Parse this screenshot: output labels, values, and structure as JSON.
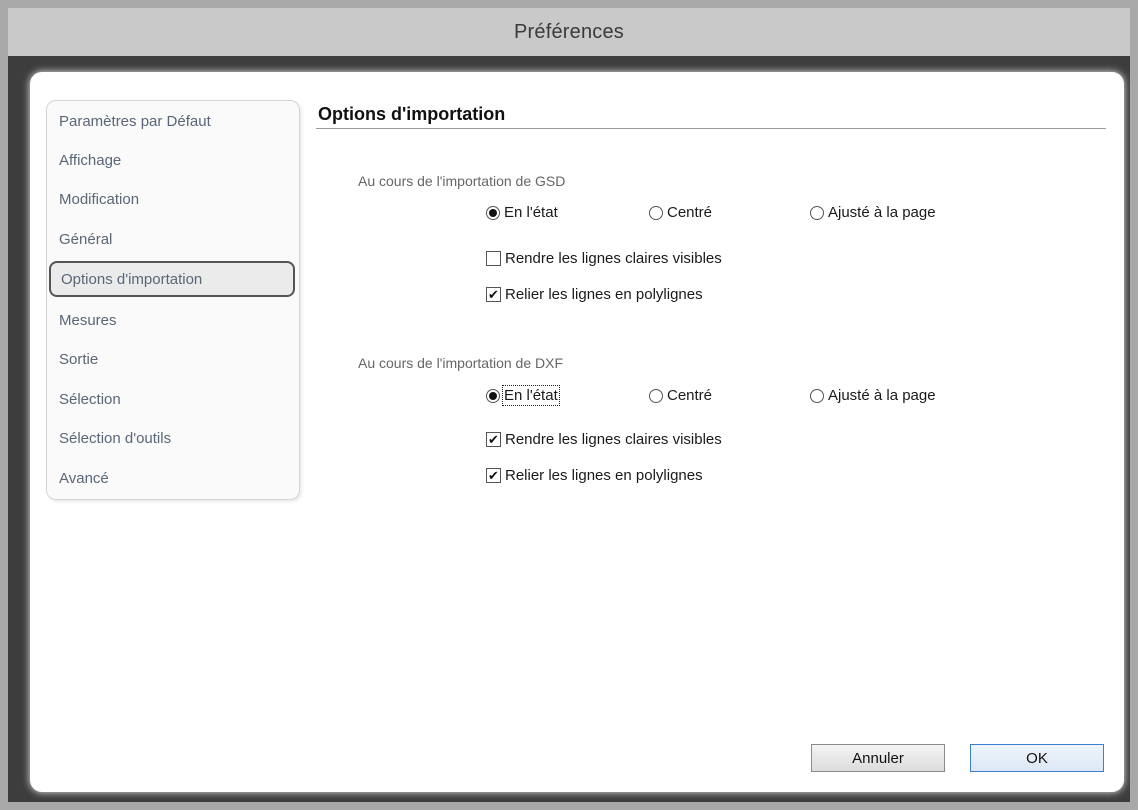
{
  "window": {
    "title": "Préférences"
  },
  "sidebar": {
    "items": [
      {
        "label": "Paramètres par Défaut"
      },
      {
        "label": "Affichage"
      },
      {
        "label": "Modification"
      },
      {
        "label": "Général"
      },
      {
        "label": "Options d'importation",
        "selected": true
      },
      {
        "label": "Mesures"
      },
      {
        "label": "Sortie"
      },
      {
        "label": "Sélection"
      },
      {
        "label": "Sélection d'outils"
      },
      {
        "label": "Avancé"
      }
    ]
  },
  "main": {
    "title": "Options d'importation",
    "gsd": {
      "label": "Au cours de l'importation de GSD",
      "radios": [
        {
          "label": "En l'état",
          "checked": true
        },
        {
          "label": "Centré",
          "checked": false
        },
        {
          "label": "Ajusté à la page",
          "checked": false
        }
      ],
      "checks": [
        {
          "label": "Rendre les lignes claires visibles",
          "checked": false
        },
        {
          "label": "Relier les lignes en polylignes",
          "checked": true
        }
      ]
    },
    "dxf": {
      "label": "Au cours de l'importation de DXF",
      "radios": [
        {
          "label": "En l'état",
          "checked": true
        },
        {
          "label": "Centré",
          "checked": false
        },
        {
          "label": "Ajusté à la page",
          "checked": false
        }
      ],
      "checks": [
        {
          "label": "Rendre les lignes claires visibles",
          "checked": true
        },
        {
          "label": "Relier les lignes en polylignes",
          "checked": true
        }
      ]
    }
  },
  "buttons": {
    "cancel": "Annuler",
    "ok": "OK"
  },
  "icons": {
    "check_mark": "✔"
  }
}
